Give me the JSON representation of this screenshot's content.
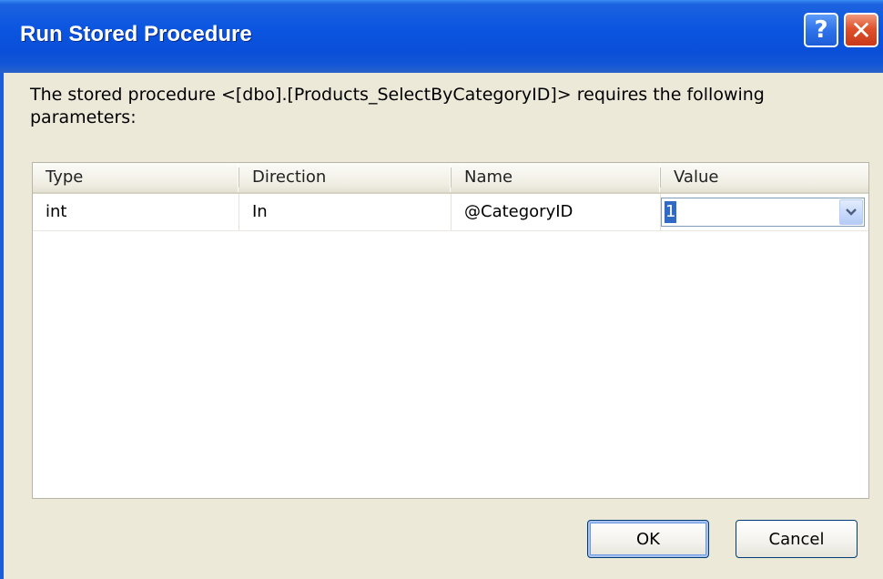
{
  "window": {
    "title": "Run Stored Procedure",
    "help_label": "?",
    "close_label": "✕"
  },
  "message": "The stored procedure <[dbo].[Products_SelectByCategoryID]> requires the following parameters:",
  "grid": {
    "columns": [
      "Type",
      "Direction",
      "Name",
      "Value"
    ],
    "rows": [
      {
        "type": "int",
        "direction": "In",
        "name": "@CategoryID",
        "value": "1"
      }
    ]
  },
  "buttons": {
    "ok": "OK",
    "cancel": "Cancel"
  },
  "icons": {
    "help": "help-icon",
    "close": "close-icon",
    "dropdown": "chevron-down-icon"
  },
  "colors": {
    "titlebar": "#0b55e0",
    "dialog_bg": "#ece9d8",
    "selection": "#316ac5",
    "close_button": "#e0522c"
  }
}
